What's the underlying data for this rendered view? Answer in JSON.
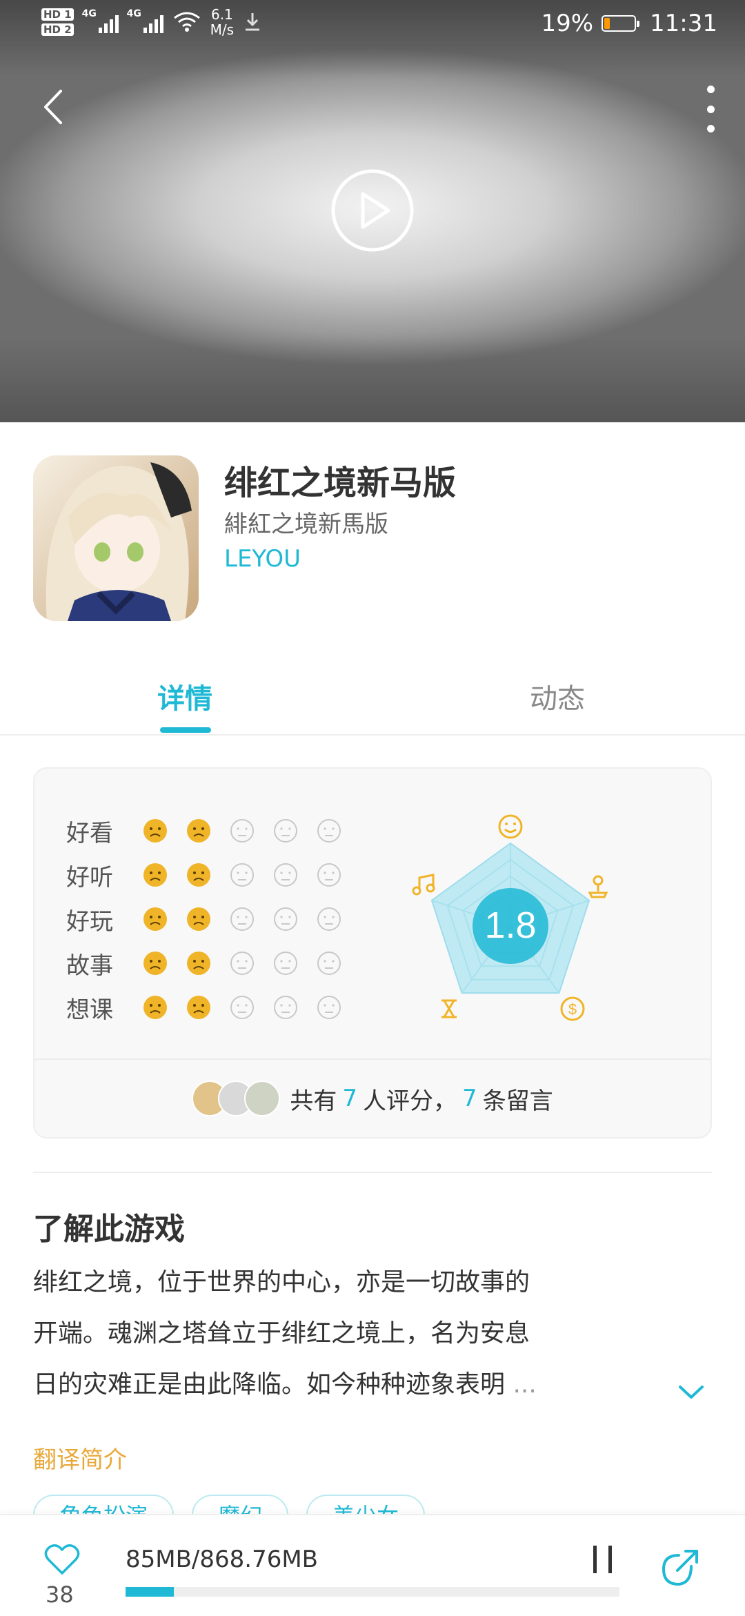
{
  "status_bar": {
    "hd1": "HD 1",
    "hd2": "HD 2",
    "net1": "4G",
    "net2": "4G",
    "speed_value": "6.1",
    "speed_unit": "M/s",
    "battery": "19%",
    "time": "11:31",
    "battery_level": 0.19,
    "battery_color": "#ff9800"
  },
  "header": {
    "back_icon": "back-arrow-icon",
    "more_icon": "more-vertical-icon",
    "play_icon": "play-icon"
  },
  "app": {
    "name": "绯红之境新马版",
    "subname": "緋紅之境新馬版",
    "developer": "LEYOU"
  },
  "tabs": [
    {
      "label": "详情",
      "active": true
    },
    {
      "label": "动态",
      "active": false
    }
  ],
  "rating": {
    "score": "1.8",
    "categories": [
      {
        "label": "好看",
        "level": 2
      },
      {
        "label": "好听",
        "level": 2
      },
      {
        "label": "好玩",
        "level": 2
      },
      {
        "label": "故事",
        "level": 2
      },
      {
        "label": "想课",
        "level": 2
      }
    ],
    "max_level": 5,
    "summary_prefix": "共有",
    "raters_count": "7",
    "raters_suffix": "人评分，",
    "comments_count": "7",
    "comments_suffix": "条留言",
    "colors": {
      "active_face": "#f0b429",
      "inactive_face": "#c8c8c8",
      "accent": "#1fb9d5"
    }
  },
  "about": {
    "title": "了解此游戏",
    "lines": [
      "绯红之境，位于世界的中心，亦是一切故事的",
      "开端。魂渊之塔耸立于绯红之境上，名为安息",
      "日的灾难正是由此降临。如今种种迹象表明"
    ],
    "ellipsis": "...",
    "translate_label": "翻译简介"
  },
  "tags": [
    "角色扮演",
    "魔幻",
    "美少女"
  ],
  "bottom_bar": {
    "favorite_count": "38",
    "download_text": "85MB/868.76MB",
    "download_progress": 0.098
  },
  "theme": {
    "accent": "#1fb9d5",
    "orange": "#e8a93b"
  }
}
